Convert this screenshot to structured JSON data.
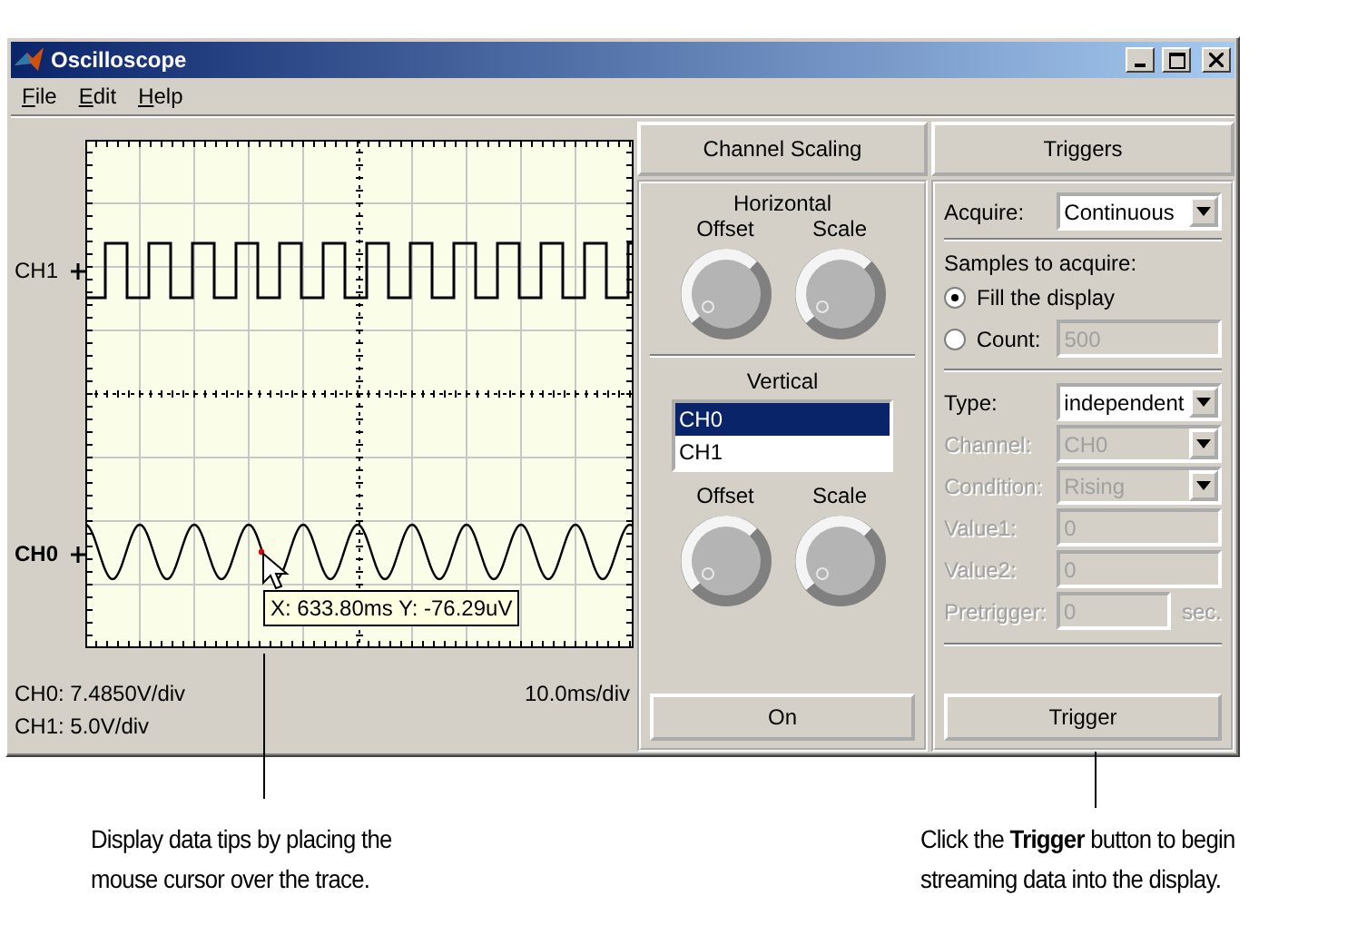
{
  "window": {
    "title": "Oscilloscope"
  },
  "menu": [
    {
      "label": "File"
    },
    {
      "label": "Edit"
    },
    {
      "label": "Help"
    }
  ],
  "display": {
    "channel_labels": [
      {
        "label": "CH1",
        "selected": false
      },
      {
        "label": "CH0",
        "selected": true
      }
    ],
    "datatip": "X: 633.80ms Y: -76.29uV",
    "scales": [
      "CH0: 7.4850V/div",
      "CH1: 5.0V/div"
    ],
    "time_scale": "10.0ms/div"
  },
  "channel_scaling": {
    "title": "Channel Scaling",
    "horizontal": {
      "heading": "Horizontal",
      "knobs": [
        "Offset",
        "Scale"
      ]
    },
    "vertical": {
      "heading": "Vertical",
      "channels": [
        {
          "name": "CH0",
          "selected": true
        },
        {
          "name": "CH1",
          "selected": false
        }
      ],
      "knobs": [
        "Offset",
        "Scale"
      ]
    },
    "button": "On"
  },
  "triggers": {
    "title": "Triggers",
    "acquire": {
      "label": "Acquire:",
      "value": "Continuous"
    },
    "samples_heading": "Samples to acquire:",
    "options": [
      {
        "label": "Fill the display",
        "selected": true
      },
      {
        "label": "Count:",
        "selected": false,
        "value": "500",
        "disabled": true
      }
    ],
    "fields": [
      {
        "kind": "select",
        "label": "Type:",
        "value": "independent",
        "disabled": false
      },
      {
        "kind": "select",
        "label": "Channel:",
        "value": "CH0",
        "disabled": true
      },
      {
        "kind": "select",
        "label": "Condition:",
        "value": "Rising",
        "disabled": true
      },
      {
        "kind": "input",
        "label": "Value1:",
        "value": "0",
        "disabled": true
      },
      {
        "kind": "input",
        "label": "Value2:",
        "value": "0",
        "disabled": true
      },
      {
        "kind": "unit",
        "label": "Pretrigger:",
        "value": "0",
        "unit": "sec.",
        "disabled": true
      }
    ],
    "button": "Trigger"
  },
  "annotations": [
    {
      "text": "Display data tips by placing the mouse cursor over the trace."
    },
    {
      "text": "Click the **Trigger** button to begin streaming data into the display."
    }
  ]
}
